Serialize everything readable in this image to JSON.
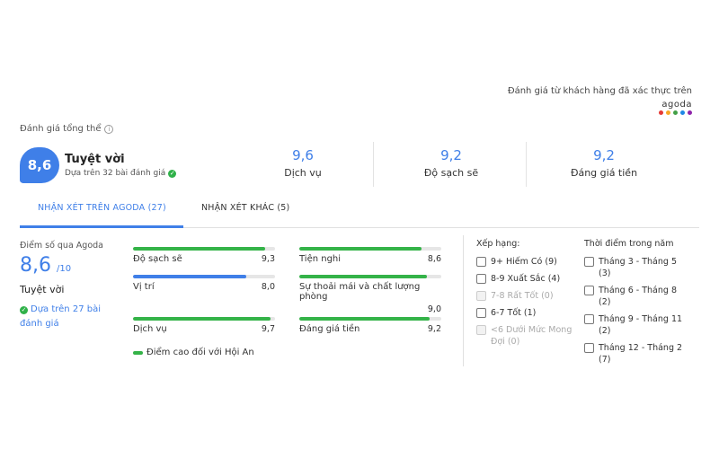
{
  "verified": {
    "text": "Đánh giá từ khách hàng đã xác thực trên",
    "brand": "agoda",
    "dot_colors": [
      "#e53935",
      "#f9a825",
      "#43a047",
      "#1e88e5",
      "#8e24aa"
    ]
  },
  "overall_label": "Đánh giá tổng thể",
  "summary": {
    "score": "8,6",
    "word": "Tuyệt vời",
    "based_on": "Dựa trên 32 bài đánh giá",
    "categories": [
      {
        "value": "9,6",
        "label": "Dịch vụ"
      },
      {
        "value": "9,2",
        "label": "Độ sạch sẽ"
      },
      {
        "value": "9,2",
        "label": "Đáng giá tiền"
      }
    ]
  },
  "tabs": {
    "active": "NHẬN XÉT TRÊN AGODA (27)",
    "other": "NHẬN XÉT KHÁC (5)"
  },
  "agoda_panel": {
    "caption": "Điểm số qua Agoda",
    "score": "8,6",
    "out_of": "/10",
    "word": "Tuyệt vời",
    "based_on": "Dựa trên 27 bài đánh giá"
  },
  "bars": [
    {
      "label": "Độ sạch sẽ",
      "value": "9,3",
      "fraction": 0.93,
      "color": "#34b348"
    },
    {
      "label": "Tiện nghi",
      "value": "8,6",
      "fraction": 0.86,
      "color": "#34b348"
    },
    {
      "label": "Vị trí",
      "value": "8,0",
      "fraction": 0.8,
      "color": "#3f7fe8"
    },
    {
      "label": "Sự thoải mái và chất lượng phòng",
      "value": "9,0",
      "fraction": 0.9,
      "color": "#34b348"
    },
    {
      "label": "Dịch vụ",
      "value": "9,7",
      "fraction": 0.97,
      "color": "#34b348"
    },
    {
      "label": "Đáng giá tiền",
      "value": "9,2",
      "fraction": 0.92,
      "color": "#34b348"
    }
  ],
  "legend": {
    "text": "Điểm cao đối với Hội An",
    "color": "#34b348"
  },
  "rating_filter": {
    "title": "Xếp hạng:",
    "options": [
      {
        "label": "9+ Hiếm Có (9)",
        "disabled": false
      },
      {
        "label": "8-9 Xuất Sắc (4)",
        "disabled": false
      },
      {
        "label": "7-8 Rất Tốt (0)",
        "disabled": true
      },
      {
        "label": "6-7 Tốt (1)",
        "disabled": false
      },
      {
        "label": "<6 Dưới Mức Mong Đợi (0)",
        "disabled": true
      }
    ]
  },
  "time_filter": {
    "title": "Thời điểm trong năm",
    "options": [
      {
        "label": "Tháng 3 - Tháng 5 (3)"
      },
      {
        "label": "Tháng 6 - Tháng 8 (2)"
      },
      {
        "label": "Tháng 9 - Tháng 11 (2)"
      },
      {
        "label": "Tháng 12 - Tháng 2 (7)"
      }
    ]
  }
}
